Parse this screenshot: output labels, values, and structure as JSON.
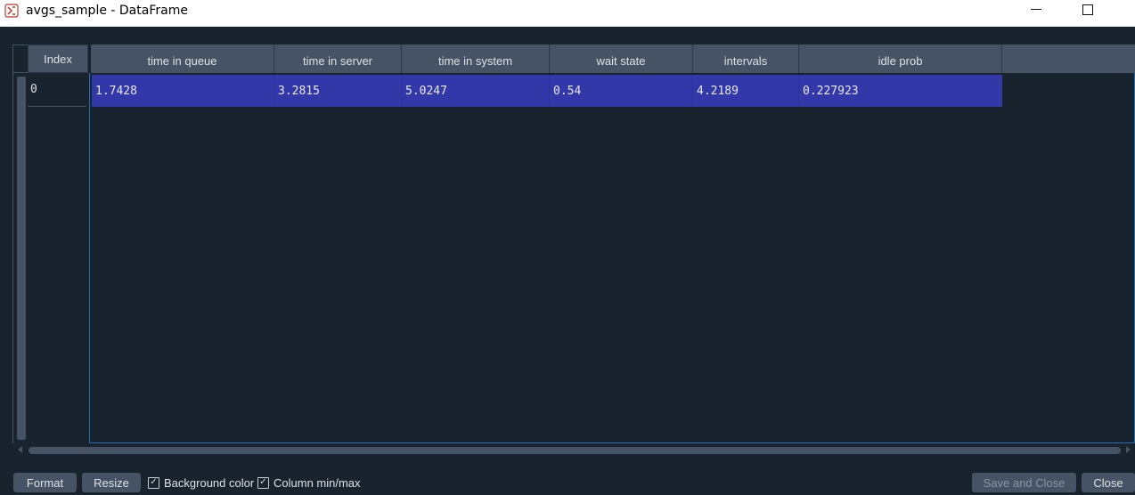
{
  "window": {
    "title": "avgs_sample - DataFrame",
    "app_icon": "spyder-icon"
  },
  "table": {
    "index_header": "Index",
    "columns": [
      "time in queue",
      "time in server",
      "time in system",
      "wait state",
      "intervals",
      "idle prob"
    ],
    "index_values": [
      "0"
    ],
    "rows": [
      [
        "1.7428",
        "3.2815",
        "5.0247",
        "0.54",
        "4.2189",
        "0.227923"
      ]
    ],
    "selection_color": "#3338a8",
    "header_color": "#455364",
    "background_color": "#19232d"
  },
  "footer": {
    "format_label": "Format",
    "resize_label": "Resize",
    "background_color_label": "Background color",
    "background_color_checked": true,
    "column_minmax_label": "Column min/max",
    "column_minmax_checked": true,
    "save_close_label": "Save and Close",
    "close_label": "Close"
  }
}
